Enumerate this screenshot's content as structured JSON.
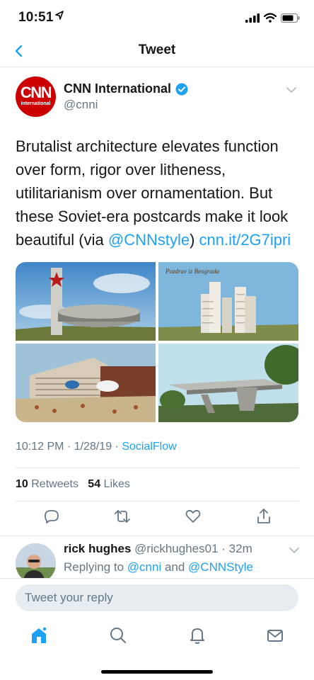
{
  "status_bar": {
    "time": "10:51"
  },
  "nav": {
    "title": "Tweet"
  },
  "tweet": {
    "author_name": "CNN International",
    "author_handle": "@cnni",
    "avatar_logo": "CNN",
    "avatar_sub": "International",
    "text_plain": "Brutalist architecture elevates function over form, rigor over litheness, utilitarianism over ornamentation. But these Soviet-era postcards make it look beautiful (via ",
    "text_mention": "@CNNstyle",
    "text_link": "cnn.it/2G7ipri",
    "media_caption": "Pozdrav iz Beograda",
    "time": "10:12 PM",
    "date": "1/28/19",
    "source": "SocialFlow",
    "retweets_count": "10",
    "retweets_label": "Retweets",
    "likes_count": "54",
    "likes_label": "Likes"
  },
  "reply": {
    "name": "rick hughes",
    "handle": "@rickhughes01",
    "time": "32m",
    "replying_prefix": "Replying to ",
    "mention_1": "@cnni",
    "and": " and ",
    "mention_2": "@CNNStyle"
  },
  "compose": {
    "placeholder": "Tweet your reply"
  },
  "tabs": [
    "home-icon",
    "search-icon",
    "notifications-icon",
    "messages-icon"
  ],
  "colors": {
    "accent": "#1da1f2",
    "cnn_red": "#cc0000",
    "muted": "#657786"
  }
}
